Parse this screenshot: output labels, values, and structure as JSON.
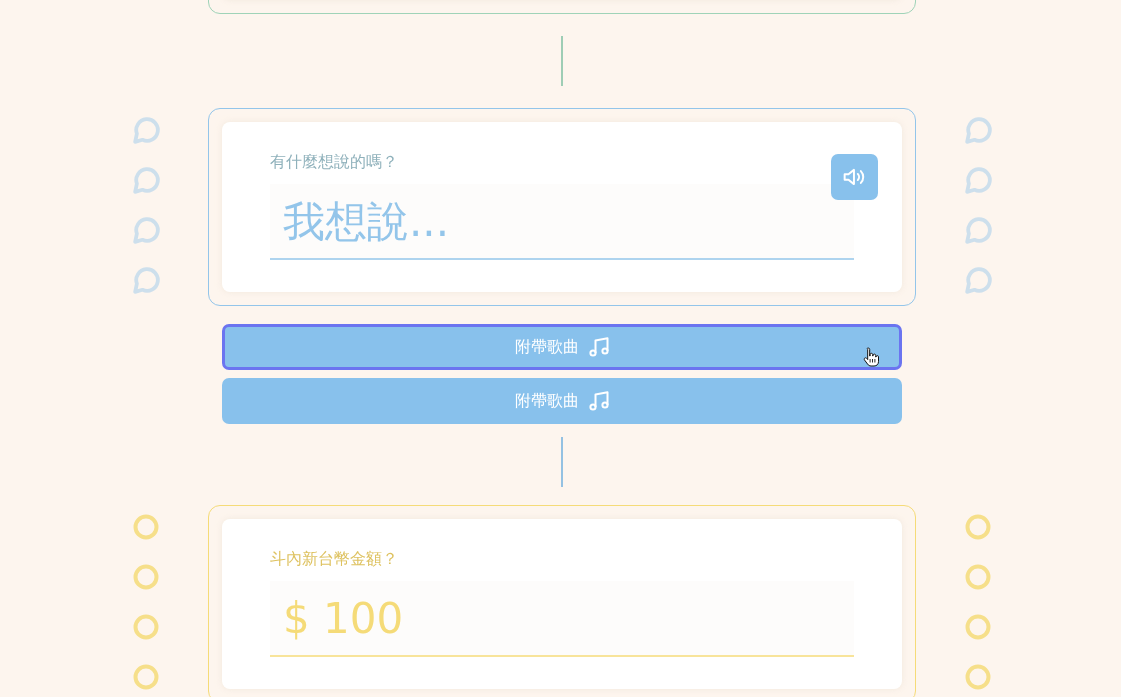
{
  "sections": [
    {
      "kind": "blank",
      "color": "#9fd3b8"
    },
    {
      "kind": "question",
      "color": "#93c5ea",
      "decoration": {
        "kind": "bubble"
      },
      "label": "有什麼想說的嗎？",
      "placeholder": "我想說...",
      "speaker": true,
      "buttons": [
        {
          "label": "附帶歌曲",
          "focused": true,
          "hovered": true
        },
        {
          "label": "附帶歌曲",
          "focused": false,
          "hovered": false
        }
      ]
    },
    {
      "kind": "question",
      "color": "#f5db78",
      "decoration": {
        "kind": "ring"
      },
      "label": "斗內新台幣金額？",
      "placeholder": "$ 100",
      "speaker": false
    }
  ]
}
